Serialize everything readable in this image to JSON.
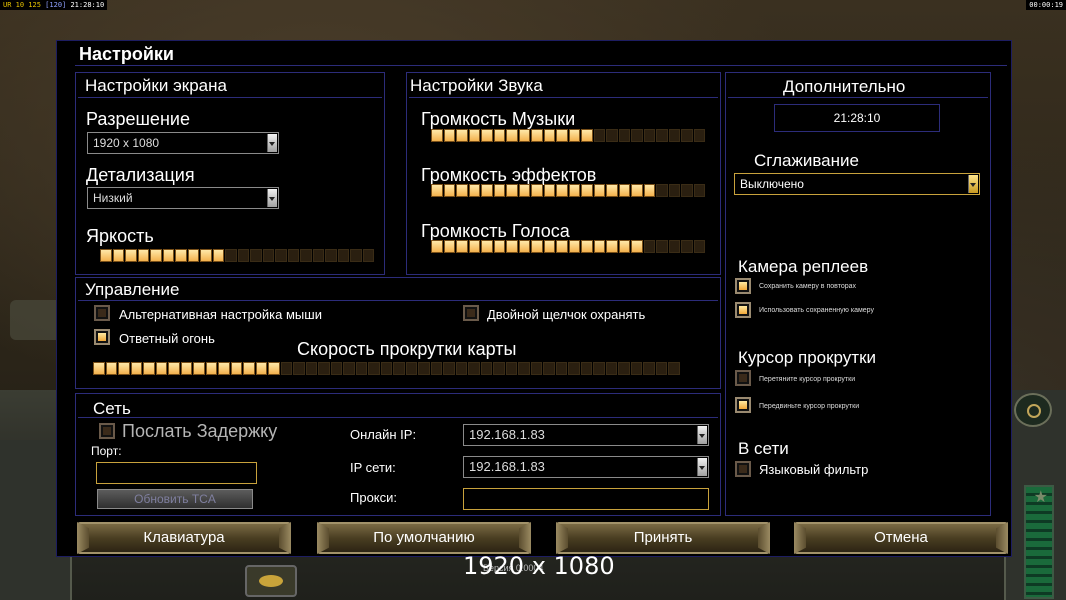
{
  "hud": {
    "left_a": "UR 10",
    "left_b": "125",
    "left_c": "[120]",
    "left_time": "21:28:10",
    "right_time": "00:00:19"
  },
  "dialog": {
    "title": "Настройки"
  },
  "screen": {
    "title": "Настройки экрана",
    "resolution_label": "Разрешение",
    "resolution_value": "1920 x 1080",
    "detail_label": "Детализация",
    "detail_value": "Низкий",
    "brightness_label": "Яркость",
    "brightness_level": 0.47
  },
  "sound": {
    "title": "Настройки Звука",
    "music_label": "Громкость Музыки",
    "music_level": 0.59,
    "effects_label": "Громкость эффектов",
    "effects_level": 0.84,
    "voice_label": "Громкость Голоса",
    "voice_level": 0.76
  },
  "extra": {
    "title": "Дополнительно",
    "clock": "21:28:10",
    "antialias_label": "Сглаживание",
    "antialias_value": "Выключено",
    "replay_camera_title": "Камера реплеев",
    "replay_save": "Сохранить камеру в повторах",
    "replay_use": "Использовать сохраненную камеру",
    "scroll_cursor_title": "Курсор прокрутки",
    "scroll_drag": "Перетяните курсор прокрутки",
    "scroll_move": "Передвиньте курсор прокрутки",
    "online_title": "В сети",
    "lang_filter": "Языковый фильтр"
  },
  "control": {
    "title": "Управление",
    "alt_mouse": "Альтернативная настройка мыши",
    "double_click": "Двойной щелчок охранять",
    "return_fire": "Ответный огонь",
    "scroll_speed_label": "Скорость прокрутки карты",
    "scroll_speed_level": 0.32
  },
  "network": {
    "title": "Сеть",
    "send_delay": "Послать Задержку",
    "port_label": "Порт:",
    "port_value": "",
    "update_tca": "Обновить TCA",
    "online_ip_label": "Онлайн IP:",
    "online_ip_value": "192.168.1.83",
    "lan_ip_label": "IP сети:",
    "lan_ip_value": "192.168.1.83",
    "proxy_label": "Прокси:",
    "proxy_value": ""
  },
  "buttons": {
    "keyboard": "Клавиатура",
    "defaults": "По умолчанию",
    "accept": "Принять",
    "cancel": "Отмена"
  },
  "footer": {
    "resolution": "1920 x 1080",
    "version": "Версия 0.0004"
  },
  "colors": {
    "accent_gold": "#c8a23c",
    "panel_border": "#2c2c7a",
    "slider_on": "#f3b24e"
  }
}
